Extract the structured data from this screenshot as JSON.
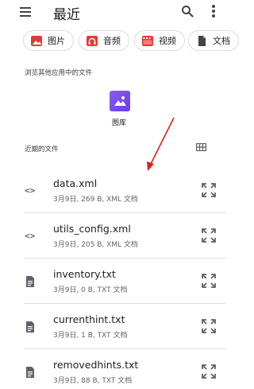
{
  "header": {
    "title": "最近"
  },
  "chips": [
    {
      "label": "图片",
      "icon": "image-icon",
      "color": "#e53935"
    },
    {
      "label": "音频",
      "icon": "headphones-icon",
      "color": "#e53935"
    },
    {
      "label": "视频",
      "icon": "movie-icon",
      "color": "#e53935"
    },
    {
      "label": "文档",
      "icon": "document-icon",
      "color": "#444444"
    }
  ],
  "other_apps": {
    "label": "浏览其他应用中的文件",
    "gallery_label": "图库"
  },
  "recent": {
    "label": "近期的文件",
    "files": [
      {
        "name": "data.xml",
        "meta": "3月9日, 269 B, XML 文档",
        "icon": "code-icon"
      },
      {
        "name": "utils_config.xml",
        "meta": "3月9日, 205 B, XML 文档",
        "icon": "code-icon"
      },
      {
        "name": "inventory.txt",
        "meta": "3月9日, 0 B, TXT 文档",
        "icon": "text-document-icon"
      },
      {
        "name": "currenthint.txt",
        "meta": "3月9日, 1 B, TXT 文档",
        "icon": "text-document-icon"
      },
      {
        "name": "removedhints.txt",
        "meta": "3月9日, 88 B, TXT 文档",
        "icon": "text-document-icon"
      }
    ]
  }
}
